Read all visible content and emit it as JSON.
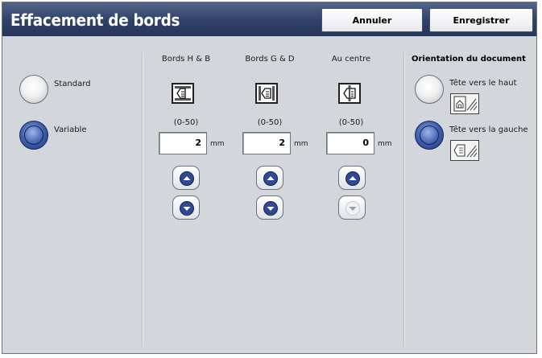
{
  "header": {
    "title": "Effacement de bords",
    "cancel_label": "Annuler",
    "save_label": "Enregistrer"
  },
  "mode": {
    "options": [
      {
        "label": "Standard",
        "selected": false
      },
      {
        "label": "Variable",
        "selected": true
      }
    ]
  },
  "columns": [
    {
      "label": "Bords H & B",
      "icon": "top-bottom-edge-icon",
      "range": "(0-50)",
      "value": "2",
      "unit": "mm",
      "up_enabled": true,
      "down_enabled": true
    },
    {
      "label": "Bords G & D",
      "icon": "left-right-edge-icon",
      "range": "(0-50)",
      "value": "2",
      "unit": "mm",
      "up_enabled": true,
      "down_enabled": true
    },
    {
      "label": "Au centre",
      "icon": "center-erase-icon",
      "range": "(0-50)",
      "value": "0",
      "unit": "mm",
      "up_enabled": true,
      "down_enabled": false
    }
  ],
  "orientation": {
    "title": "Orientation du document",
    "options": [
      {
        "label": "Tête vers le haut",
        "icon": "head-up-icon",
        "selected": false
      },
      {
        "label": "Tête vers la gauche",
        "icon": "head-left-icon",
        "selected": true
      }
    ]
  },
  "colors": {
    "header": "#2f4166",
    "panel": "#d3d7dc",
    "selected_radio": "#3f5fb0"
  }
}
